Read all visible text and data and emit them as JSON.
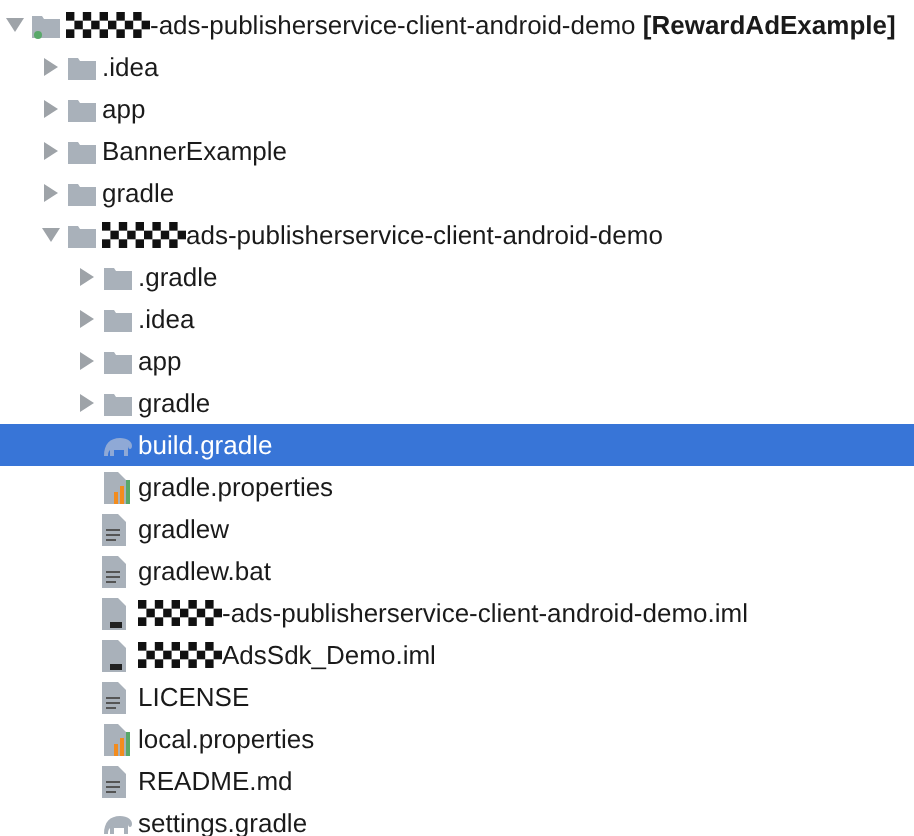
{
  "tree": {
    "name": "-ads-publisherservice-client-android-demo **[RewardAdExample]**",
    "kind": "module",
    "redacted": true,
    "expanded": true,
    "selected": false,
    "children": [
      {
        "name": ".idea",
        "kind": "folder",
        "expanded": false,
        "selected": false
      },
      {
        "name": "app",
        "kind": "folder",
        "expanded": false,
        "selected": false
      },
      {
        "name": "BannerExample",
        "kind": "folder",
        "expanded": false,
        "selected": false
      },
      {
        "name": "gradle",
        "kind": "folder",
        "expanded": false,
        "selected": false
      },
      {
        "name": "ads-publisherservice-client-android-demo",
        "kind": "folder",
        "redacted": true,
        "expanded": true,
        "selected": false,
        "children": [
          {
            "name": ".gradle",
            "kind": "folder",
            "expanded": false,
            "selected": false
          },
          {
            "name": ".idea",
            "kind": "folder",
            "expanded": false,
            "selected": false
          },
          {
            "name": "app",
            "kind": "folder",
            "expanded": false,
            "selected": false
          },
          {
            "name": "gradle",
            "kind": "folder",
            "expanded": false,
            "selected": false
          },
          {
            "name": "build.gradle",
            "kind": "gradle",
            "selected": true
          },
          {
            "name": "gradle.properties",
            "kind": "properties",
            "selected": false
          },
          {
            "name": "gradlew",
            "kind": "text",
            "selected": false
          },
          {
            "name": "gradlew.bat",
            "kind": "text",
            "selected": false
          },
          {
            "name": "-ads-publisherservice-client-android-demo.iml",
            "kind": "iml",
            "redacted": true,
            "selected": false
          },
          {
            "name": "AdsSdk_Demo.iml",
            "kind": "iml",
            "redacted": true,
            "selected": false
          },
          {
            "name": "LICENSE",
            "kind": "text",
            "selected": false
          },
          {
            "name": "local.properties",
            "kind": "properties",
            "selected": false
          },
          {
            "name": "README.md",
            "kind": "text",
            "selected": false
          },
          {
            "name": "settings.gradle",
            "kind": "gradle",
            "selected": false
          }
        ]
      }
    ]
  }
}
